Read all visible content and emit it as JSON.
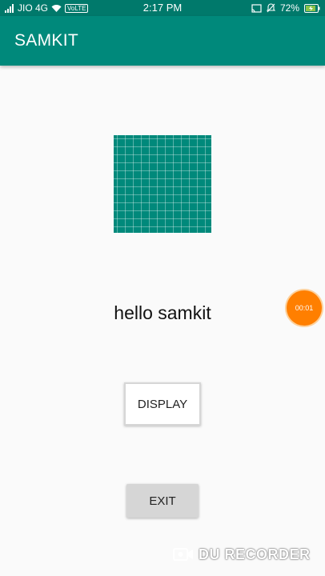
{
  "status_bar": {
    "carrier": "JIO 4G",
    "volte": "VoLTE",
    "time": "2:17 PM",
    "battery": "72%"
  },
  "app_bar": {
    "title": "SAMKIT"
  },
  "main": {
    "message": "hello samkit",
    "display_button_label": "DISPLAY",
    "exit_button_label": "EXIT"
  },
  "overlay": {
    "recorder_timer": "00:01",
    "watermark": "DU RECORDER"
  },
  "colors": {
    "primary": "#00897b",
    "primary_dark": "#00796b",
    "accent": "#ff7f00",
    "background": "#fafafa"
  }
}
